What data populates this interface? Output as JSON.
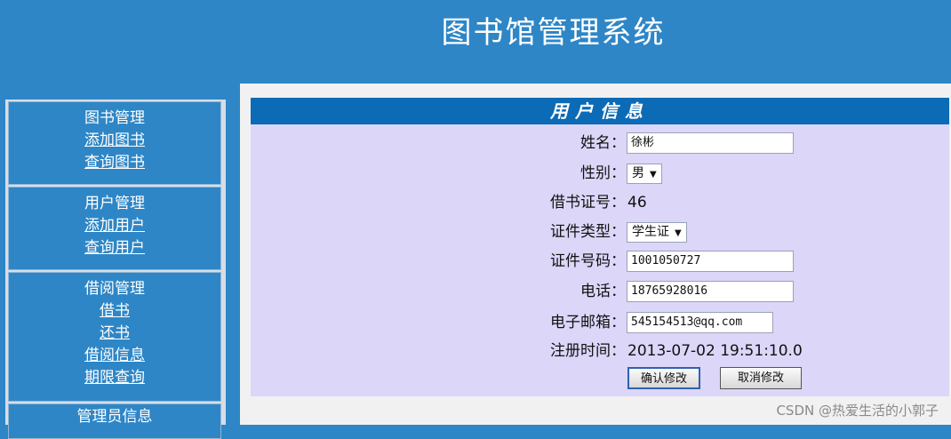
{
  "app": {
    "title": "图书馆管理系统"
  },
  "sidebar": {
    "groups": [
      {
        "title": "图书管理",
        "links": [
          "添加图书",
          "查询图书"
        ]
      },
      {
        "title": "用户管理",
        "links": [
          "添加用户",
          "查询用户"
        ]
      },
      {
        "title": "借阅管理",
        "links": [
          "借书",
          "还书",
          "借阅信息",
          "期限查询"
        ]
      },
      {
        "title": "管理员信息",
        "links": []
      }
    ]
  },
  "form": {
    "heading": "用户信息",
    "name": {
      "label": "姓名：",
      "value": "徐彬"
    },
    "gender": {
      "label": "性别：",
      "value": "男"
    },
    "card": {
      "label": "借书证号：",
      "value": "46"
    },
    "id_type": {
      "label": "证件类型：",
      "value": "学生证"
    },
    "id_number": {
      "label": "证件号码：",
      "value": "1001050727"
    },
    "phone": {
      "label": "电话：",
      "value": "18765928016"
    },
    "email": {
      "label": "电子邮箱：",
      "value": "545154513@qq.com"
    },
    "reg_time": {
      "label": "注册时间：",
      "value": "2013-07-02 19:51:10.0"
    },
    "confirm_label": "确认修改",
    "cancel_label": "取消修改"
  },
  "watermark": "CSDN @热爱生活的小郭子"
}
